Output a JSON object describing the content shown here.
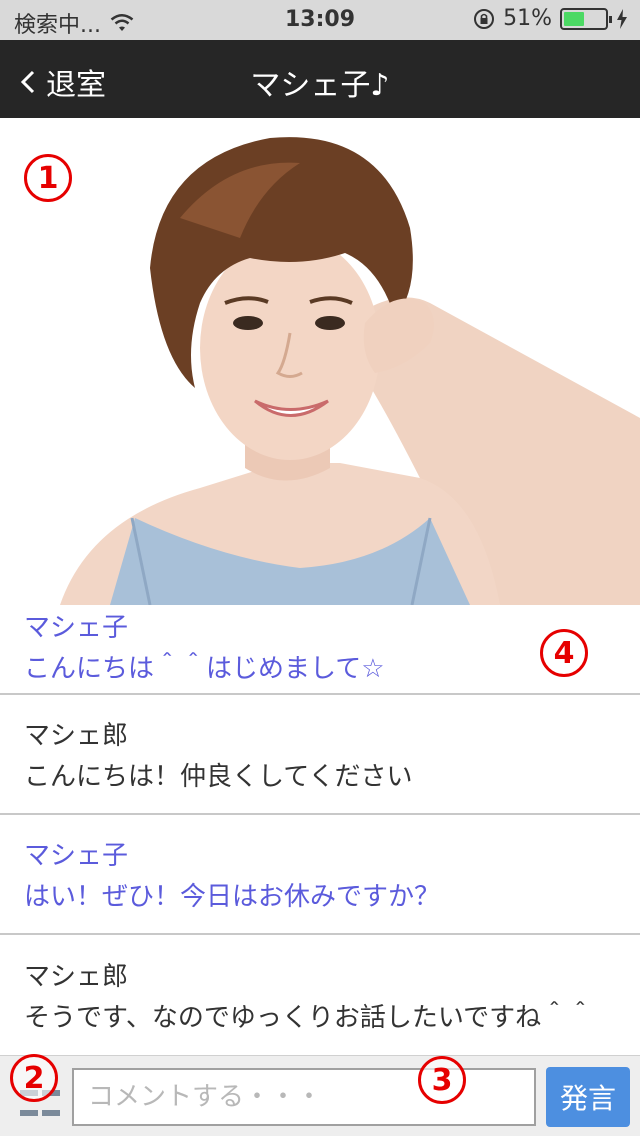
{
  "status_bar": {
    "carrier": "検索中...",
    "time": "13:09",
    "battery_percent": "51%",
    "battery_level": 0.51,
    "icons": [
      "wifi-icon",
      "rotation-lock-icon",
      "battery-icon",
      "charging-icon"
    ]
  },
  "nav": {
    "back_label": "退室",
    "title": "マシェ子♪"
  },
  "markers": {
    "m1": "1",
    "m2": "2",
    "m3": "3",
    "m4": "4"
  },
  "messages": [
    {
      "sender": "マシェ子",
      "text": "こんにちは＾＾はじめまして☆",
      "role": "partner"
    },
    {
      "sender": "マシェ郎",
      "text": "こんにちは！仲良くしてください",
      "role": "self"
    },
    {
      "sender": "マシェ子",
      "text": "はい！ぜひ！今日はお休みですか？",
      "role": "partner"
    },
    {
      "sender": "マシェ郎",
      "text": "そうです、なのでゆっくりお話したいですね＾＾",
      "role": "self"
    }
  ],
  "input": {
    "placeholder": "コメントする・・・",
    "send_label": "発言"
  },
  "colors": {
    "partner_text": "#5b5bdc",
    "self_text": "#333333",
    "nav_bg": "#262626",
    "send_button": "#4d8fe0",
    "marker": "#e60000"
  }
}
